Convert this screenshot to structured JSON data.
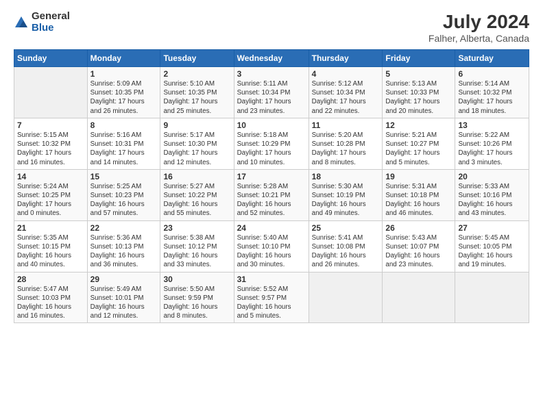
{
  "header": {
    "logo_general": "General",
    "logo_blue": "Blue",
    "title": "July 2024",
    "subtitle": "Falher, Alberta, Canada"
  },
  "days_of_week": [
    "Sunday",
    "Monday",
    "Tuesday",
    "Wednesday",
    "Thursday",
    "Friday",
    "Saturday"
  ],
  "weeks": [
    [
      {
        "day": "",
        "info": ""
      },
      {
        "day": "1",
        "info": "Sunrise: 5:09 AM\nSunset: 10:35 PM\nDaylight: 17 hours\nand 26 minutes."
      },
      {
        "day": "2",
        "info": "Sunrise: 5:10 AM\nSunset: 10:35 PM\nDaylight: 17 hours\nand 25 minutes."
      },
      {
        "day": "3",
        "info": "Sunrise: 5:11 AM\nSunset: 10:34 PM\nDaylight: 17 hours\nand 23 minutes."
      },
      {
        "day": "4",
        "info": "Sunrise: 5:12 AM\nSunset: 10:34 PM\nDaylight: 17 hours\nand 22 minutes."
      },
      {
        "day": "5",
        "info": "Sunrise: 5:13 AM\nSunset: 10:33 PM\nDaylight: 17 hours\nand 20 minutes."
      },
      {
        "day": "6",
        "info": "Sunrise: 5:14 AM\nSunset: 10:32 PM\nDaylight: 17 hours\nand 18 minutes."
      }
    ],
    [
      {
        "day": "7",
        "info": "Sunrise: 5:15 AM\nSunset: 10:32 PM\nDaylight: 17 hours\nand 16 minutes."
      },
      {
        "day": "8",
        "info": "Sunrise: 5:16 AM\nSunset: 10:31 PM\nDaylight: 17 hours\nand 14 minutes."
      },
      {
        "day": "9",
        "info": "Sunrise: 5:17 AM\nSunset: 10:30 PM\nDaylight: 17 hours\nand 12 minutes."
      },
      {
        "day": "10",
        "info": "Sunrise: 5:18 AM\nSunset: 10:29 PM\nDaylight: 17 hours\nand 10 minutes."
      },
      {
        "day": "11",
        "info": "Sunrise: 5:20 AM\nSunset: 10:28 PM\nDaylight: 17 hours\nand 8 minutes."
      },
      {
        "day": "12",
        "info": "Sunrise: 5:21 AM\nSunset: 10:27 PM\nDaylight: 17 hours\nand 5 minutes."
      },
      {
        "day": "13",
        "info": "Sunrise: 5:22 AM\nSunset: 10:26 PM\nDaylight: 17 hours\nand 3 minutes."
      }
    ],
    [
      {
        "day": "14",
        "info": "Sunrise: 5:24 AM\nSunset: 10:25 PM\nDaylight: 17 hours\nand 0 minutes."
      },
      {
        "day": "15",
        "info": "Sunrise: 5:25 AM\nSunset: 10:23 PM\nDaylight: 16 hours\nand 57 minutes."
      },
      {
        "day": "16",
        "info": "Sunrise: 5:27 AM\nSunset: 10:22 PM\nDaylight: 16 hours\nand 55 minutes."
      },
      {
        "day": "17",
        "info": "Sunrise: 5:28 AM\nSunset: 10:21 PM\nDaylight: 16 hours\nand 52 minutes."
      },
      {
        "day": "18",
        "info": "Sunrise: 5:30 AM\nSunset: 10:19 PM\nDaylight: 16 hours\nand 49 minutes."
      },
      {
        "day": "19",
        "info": "Sunrise: 5:31 AM\nSunset: 10:18 PM\nDaylight: 16 hours\nand 46 minutes."
      },
      {
        "day": "20",
        "info": "Sunrise: 5:33 AM\nSunset: 10:16 PM\nDaylight: 16 hours\nand 43 minutes."
      }
    ],
    [
      {
        "day": "21",
        "info": "Sunrise: 5:35 AM\nSunset: 10:15 PM\nDaylight: 16 hours\nand 40 minutes."
      },
      {
        "day": "22",
        "info": "Sunrise: 5:36 AM\nSunset: 10:13 PM\nDaylight: 16 hours\nand 36 minutes."
      },
      {
        "day": "23",
        "info": "Sunrise: 5:38 AM\nSunset: 10:12 PM\nDaylight: 16 hours\nand 33 minutes."
      },
      {
        "day": "24",
        "info": "Sunrise: 5:40 AM\nSunset: 10:10 PM\nDaylight: 16 hours\nand 30 minutes."
      },
      {
        "day": "25",
        "info": "Sunrise: 5:41 AM\nSunset: 10:08 PM\nDaylight: 16 hours\nand 26 minutes."
      },
      {
        "day": "26",
        "info": "Sunrise: 5:43 AM\nSunset: 10:07 PM\nDaylight: 16 hours\nand 23 minutes."
      },
      {
        "day": "27",
        "info": "Sunrise: 5:45 AM\nSunset: 10:05 PM\nDaylight: 16 hours\nand 19 minutes."
      }
    ],
    [
      {
        "day": "28",
        "info": "Sunrise: 5:47 AM\nSunset: 10:03 PM\nDaylight: 16 hours\nand 16 minutes."
      },
      {
        "day": "29",
        "info": "Sunrise: 5:49 AM\nSunset: 10:01 PM\nDaylight: 16 hours\nand 12 minutes."
      },
      {
        "day": "30",
        "info": "Sunrise: 5:50 AM\nSunset: 9:59 PM\nDaylight: 16 hours\nand 8 minutes."
      },
      {
        "day": "31",
        "info": "Sunrise: 5:52 AM\nSunset: 9:57 PM\nDaylight: 16 hours\nand 5 minutes."
      },
      {
        "day": "",
        "info": ""
      },
      {
        "day": "",
        "info": ""
      },
      {
        "day": "",
        "info": ""
      }
    ]
  ]
}
